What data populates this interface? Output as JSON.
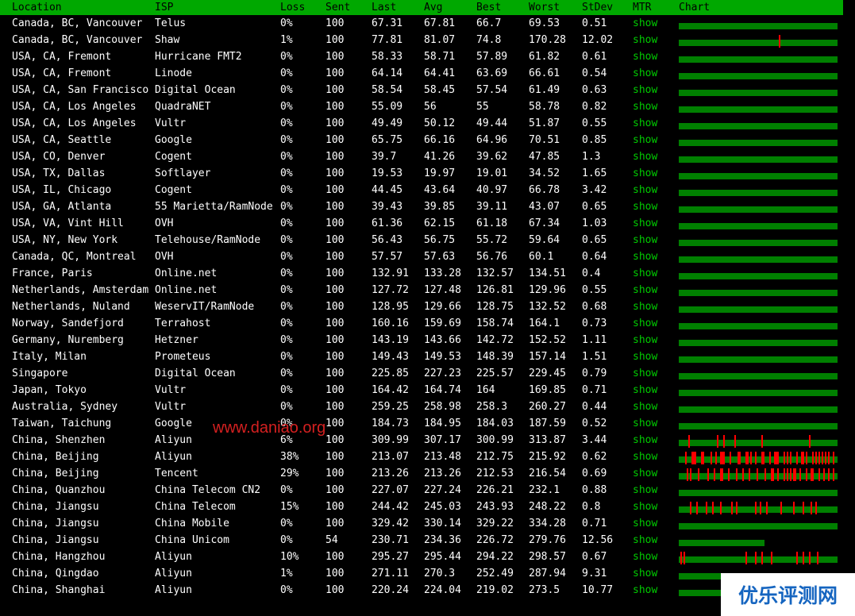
{
  "header": {
    "location": "Location",
    "isp": "ISP",
    "loss": "Loss",
    "sent": "Sent",
    "last": "Last",
    "avg": "Avg",
    "best": "Best",
    "worst": "Worst",
    "stdev": "StDev",
    "mtr": "MTR",
    "chart": "Chart"
  },
  "colors": {
    "header_bg": "#00a800",
    "link": "#00cc00",
    "bar_ok": "#008000",
    "bar_loss": "#ff0000",
    "bar_partial": "#8b4513",
    "watermark": "#d42020",
    "logo_text": "#1565c0"
  },
  "watermark": "www.daniao.org",
  "logo": "优乐评测网",
  "rows": [
    {
      "location": "Canada, BC, Vancouver",
      "isp": "Telus",
      "loss": "0%",
      "sent": "100",
      "last": "67.31",
      "avg": "67.81",
      "best": "66.7",
      "worst": "69.53",
      "stdev": "0.51",
      "mtr": "show",
      "chart": {
        "fill": 1,
        "loss": []
      }
    },
    {
      "location": "Canada, BC, Vancouver",
      "isp": "Shaw",
      "loss": "1%",
      "sent": "100",
      "last": "77.81",
      "avg": "81.07",
      "best": "74.8",
      "worst": "170.28",
      "stdev": "12.02",
      "mtr": "show",
      "chart": {
        "fill": 1,
        "loss": [
          63
        ]
      }
    },
    {
      "location": "USA, CA, Fremont",
      "isp": "Hurricane FMT2",
      "loss": "0%",
      "sent": "100",
      "last": "58.33",
      "avg": "58.71",
      "best": "57.89",
      "worst": "61.82",
      "stdev": "0.61",
      "mtr": "show",
      "chart": {
        "fill": 1,
        "loss": []
      }
    },
    {
      "location": "USA, CA, Fremont",
      "isp": "Linode",
      "loss": "0%",
      "sent": "100",
      "last": "64.14",
      "avg": "64.41",
      "best": "63.69",
      "worst": "66.61",
      "stdev": "0.54",
      "mtr": "show",
      "chart": {
        "fill": 1,
        "loss": []
      }
    },
    {
      "location": "USA, CA, San Francisco",
      "isp": "Digital Ocean",
      "loss": "0%",
      "sent": "100",
      "last": "58.54",
      "avg": "58.45",
      "best": "57.54",
      "worst": "61.49",
      "stdev": "0.63",
      "mtr": "show",
      "chart": {
        "fill": 1,
        "loss": []
      }
    },
    {
      "location": "USA, CA, Los Angeles",
      "isp": "QuadraNET",
      "loss": "0%",
      "sent": "100",
      "last": "55.09",
      "avg": "56",
      "best": "55",
      "worst": "58.78",
      "stdev": "0.82",
      "mtr": "show",
      "chart": {
        "fill": 1,
        "loss": []
      }
    },
    {
      "location": "USA, CA, Los Angeles",
      "isp": "Vultr",
      "loss": "0%",
      "sent": "100",
      "last": "49.49",
      "avg": "50.12",
      "best": "49.44",
      "worst": "51.87",
      "stdev": "0.55",
      "mtr": "show",
      "chart": {
        "fill": 1,
        "loss": []
      }
    },
    {
      "location": "USA, CA, Seattle",
      "isp": "Google",
      "loss": "0%",
      "sent": "100",
      "last": "65.75",
      "avg": "66.16",
      "best": "64.96",
      "worst": "70.51",
      "stdev": "0.85",
      "mtr": "show",
      "chart": {
        "fill": 1,
        "loss": []
      }
    },
    {
      "location": "USA, CO, Denver",
      "isp": "Cogent",
      "loss": "0%",
      "sent": "100",
      "last": "39.7",
      "avg": "41.26",
      "best": "39.62",
      "worst": "47.85",
      "stdev": "1.3",
      "mtr": "show",
      "chart": {
        "fill": 1,
        "loss": []
      }
    },
    {
      "location": "USA, TX, Dallas",
      "isp": "Softlayer",
      "loss": "0%",
      "sent": "100",
      "last": "19.53",
      "avg": "19.97",
      "best": "19.01",
      "worst": "34.52",
      "stdev": "1.65",
      "mtr": "show",
      "chart": {
        "fill": 1,
        "loss": []
      }
    },
    {
      "location": "USA, IL, Chicago",
      "isp": "Cogent",
      "loss": "0%",
      "sent": "100",
      "last": "44.45",
      "avg": "43.64",
      "best": "40.97",
      "worst": "66.78",
      "stdev": "3.42",
      "mtr": "show",
      "chart": {
        "fill": 1,
        "loss": []
      }
    },
    {
      "location": "USA, GA, Atlanta",
      "isp": "55 Marietta/RamNode",
      "loss": "0%",
      "sent": "100",
      "last": "39.43",
      "avg": "39.85",
      "best": "39.11",
      "worst": "43.07",
      "stdev": "0.65",
      "mtr": "show",
      "chart": {
        "fill": 1,
        "loss": []
      }
    },
    {
      "location": "USA, VA, Vint Hill",
      "isp": "OVH",
      "loss": "0%",
      "sent": "100",
      "last": "61.36",
      "avg": "62.15",
      "best": "61.18",
      "worst": "67.34",
      "stdev": "1.03",
      "mtr": "show",
      "chart": {
        "fill": 1,
        "loss": []
      }
    },
    {
      "location": "USA, NY, New York",
      "isp": "Telehouse/RamNode",
      "loss": "0%",
      "sent": "100",
      "last": "56.43",
      "avg": "56.75",
      "best": "55.72",
      "worst": "59.64",
      "stdev": "0.65",
      "mtr": "show",
      "chart": {
        "fill": 1,
        "loss": []
      }
    },
    {
      "location": "Canada, QC, Montreal",
      "isp": "OVH",
      "loss": "0%",
      "sent": "100",
      "last": "57.57",
      "avg": "57.63",
      "best": "56.76",
      "worst": "60.1",
      "stdev": "0.64",
      "mtr": "show",
      "chart": {
        "fill": 1,
        "loss": []
      }
    },
    {
      "location": "France, Paris",
      "isp": "Online.net",
      "loss": "0%",
      "sent": "100",
      "last": "132.91",
      "avg": "133.28",
      "best": "132.57",
      "worst": "134.51",
      "stdev": "0.4",
      "mtr": "show",
      "chart": {
        "fill": 1,
        "loss": []
      }
    },
    {
      "location": "Netherlands, Amsterdam",
      "isp": "Online.net",
      "loss": "0%",
      "sent": "100",
      "last": "127.72",
      "avg": "127.48",
      "best": "126.81",
      "worst": "129.96",
      "stdev": "0.55",
      "mtr": "show",
      "chart": {
        "fill": 1,
        "loss": []
      }
    },
    {
      "location": "Netherlands, Nuland",
      "isp": "WeservIT/RamNode",
      "loss": "0%",
      "sent": "100",
      "last": "128.95",
      "avg": "129.66",
      "best": "128.75",
      "worst": "132.52",
      "stdev": "0.68",
      "mtr": "show",
      "chart": {
        "fill": 1,
        "loss": []
      }
    },
    {
      "location": "Norway, Sandefjord",
      "isp": "Terrahost",
      "loss": "0%",
      "sent": "100",
      "last": "160.16",
      "avg": "159.69",
      "best": "158.74",
      "worst": "164.1",
      "stdev": "0.73",
      "mtr": "show",
      "chart": {
        "fill": 1,
        "loss": []
      }
    },
    {
      "location": "Germany, Nuremberg",
      "isp": "Hetzner",
      "loss": "0%",
      "sent": "100",
      "last": "143.19",
      "avg": "143.66",
      "best": "142.72",
      "worst": "152.52",
      "stdev": "1.11",
      "mtr": "show",
      "chart": {
        "fill": 1,
        "loss": []
      }
    },
    {
      "location": "Italy, Milan",
      "isp": "Prometeus",
      "loss": "0%",
      "sent": "100",
      "last": "149.43",
      "avg": "149.53",
      "best": "148.39",
      "worst": "157.14",
      "stdev": "1.51",
      "mtr": "show",
      "chart": {
        "fill": 1,
        "loss": []
      }
    },
    {
      "location": "Singapore",
      "isp": "Digital Ocean",
      "loss": "0%",
      "sent": "100",
      "last": "225.85",
      "avg": "227.23",
      "best": "225.57",
      "worst": "229.45",
      "stdev": "0.79",
      "mtr": "show",
      "chart": {
        "fill": 1,
        "loss": []
      }
    },
    {
      "location": "Japan, Tokyo",
      "isp": "Vultr",
      "loss": "0%",
      "sent": "100",
      "last": "164.42",
      "avg": "164.74",
      "best": "164",
      "worst": "169.85",
      "stdev": "0.71",
      "mtr": "show",
      "chart": {
        "fill": 1,
        "loss": []
      }
    },
    {
      "location": "Australia, Sydney",
      "isp": "Vultr",
      "loss": "0%",
      "sent": "100",
      "last": "259.25",
      "avg": "258.98",
      "best": "258.3",
      "worst": "260.27",
      "stdev": "0.44",
      "mtr": "show",
      "chart": {
        "fill": 1,
        "loss": []
      }
    },
    {
      "location": "Taiwan, Taichung",
      "isp": "Google",
      "loss": "0%",
      "sent": "100",
      "last": "184.73",
      "avg": "184.95",
      "best": "184.03",
      "worst": "187.59",
      "stdev": "0.52",
      "mtr": "show",
      "chart": {
        "fill": 1,
        "loss": []
      }
    },
    {
      "location": "China, Shenzhen",
      "isp": "Aliyun",
      "loss": "6%",
      "sent": "100",
      "last": "309.99",
      "avg": "307.17",
      "best": "300.99",
      "worst": "313.87",
      "stdev": "3.44",
      "mtr": "show",
      "chart": {
        "fill": 1,
        "loss": [
          6,
          24,
          28,
          35,
          52,
          82
        ]
      }
    },
    {
      "location": "China, Beijing",
      "isp": "Aliyun",
      "loss": "38%",
      "sent": "100",
      "last": "213.07",
      "avg": "213.48",
      "best": "212.75",
      "worst": "215.92",
      "stdev": "0.62",
      "mtr": "show",
      "chart": {
        "fill": 1,
        "loss": [
          4,
          8,
          9,
          10,
          14,
          15,
          20,
          23,
          26,
          27,
          28,
          32,
          37,
          38,
          42,
          43,
          45,
          48,
          52,
          53,
          57,
          60,
          61,
          62,
          66,
          68,
          70,
          74,
          77,
          78,
          80,
          84,
          86,
          88,
          90,
          92,
          94,
          97
        ]
      }
    },
    {
      "location": "China, Beijing",
      "isp": "Tencent",
      "loss": "29%",
      "sent": "100",
      "last": "213.26",
      "avg": "213.26",
      "best": "212.53",
      "worst": "216.54",
      "stdev": "0.69",
      "mtr": "show",
      "chart": {
        "fill": 1,
        "loss": [
          5,
          7,
          12,
          18,
          22,
          26,
          27,
          31,
          36,
          40,
          44,
          49,
          54,
          58,
          59,
          62,
          66,
          68,
          70,
          72,
          73,
          76,
          80,
          83,
          84,
          88,
          91,
          94,
          97
        ]
      }
    },
    {
      "location": "China, Quanzhou",
      "isp": "China Telecom CN2",
      "loss": "0%",
      "sent": "100",
      "last": "227.07",
      "avg": "227.24",
      "best": "226.21",
      "worst": "232.1",
      "stdev": "0.88",
      "mtr": "show",
      "chart": {
        "fill": 1,
        "loss": []
      }
    },
    {
      "location": "China, Jiangsu",
      "isp": "China Telecom",
      "loss": "15%",
      "sent": "100",
      "last": "244.42",
      "avg": "245.03",
      "best": "243.93",
      "worst": "248.22",
      "stdev": "0.8",
      "mtr": "show",
      "chart": {
        "fill": 1,
        "loss": [
          7,
          11,
          17,
          21,
          26,
          33,
          36,
          48,
          51,
          55,
          64,
          72,
          78,
          83,
          86
        ]
      }
    },
    {
      "location": "China, Jiangsu",
      "isp": "China Mobile",
      "loss": "0%",
      "sent": "100",
      "last": "329.42",
      "avg": "330.14",
      "best": "329.22",
      "worst": "334.28",
      "stdev": "0.71",
      "mtr": "show",
      "chart": {
        "fill": 1,
        "loss": []
      }
    },
    {
      "location": "China, Jiangsu",
      "isp": "China Unicom",
      "loss": "0%",
      "sent": "54",
      "last": "230.71",
      "avg": "234.36",
      "best": "226.72",
      "worst": "279.76",
      "stdev": "12.56",
      "mtr": "show",
      "chart": {
        "fill": 0.54,
        "loss": []
      }
    },
    {
      "location": "China, Hangzhou",
      "isp": "Aliyun",
      "loss": "10%",
      "sent": "100",
      "last": "295.27",
      "avg": "295.44",
      "best": "294.22",
      "worst": "298.57",
      "stdev": "0.67",
      "mtr": "show",
      "chart": {
        "fill": 1,
        "loss": [
          1,
          3,
          42,
          48,
          52,
          58,
          74,
          78,
          82,
          87
        ]
      }
    },
    {
      "location": "China, Qingdao",
      "isp": "Aliyun",
      "loss": "1%",
      "sent": "100",
      "last": "271.11",
      "avg": "270.3",
      "best": "252.49",
      "worst": "287.94",
      "stdev": "9.31",
      "mtr": "show",
      "chart": {
        "fill": 1,
        "loss": []
      }
    },
    {
      "location": "China, Shanghai",
      "isp": "Aliyun",
      "loss": "0%",
      "sent": "100",
      "last": "220.24",
      "avg": "224.04",
      "best": "219.02",
      "worst": "273.5",
      "stdev": "10.77",
      "mtr": "show",
      "chart": {
        "fill": 1,
        "loss": []
      }
    }
  ]
}
